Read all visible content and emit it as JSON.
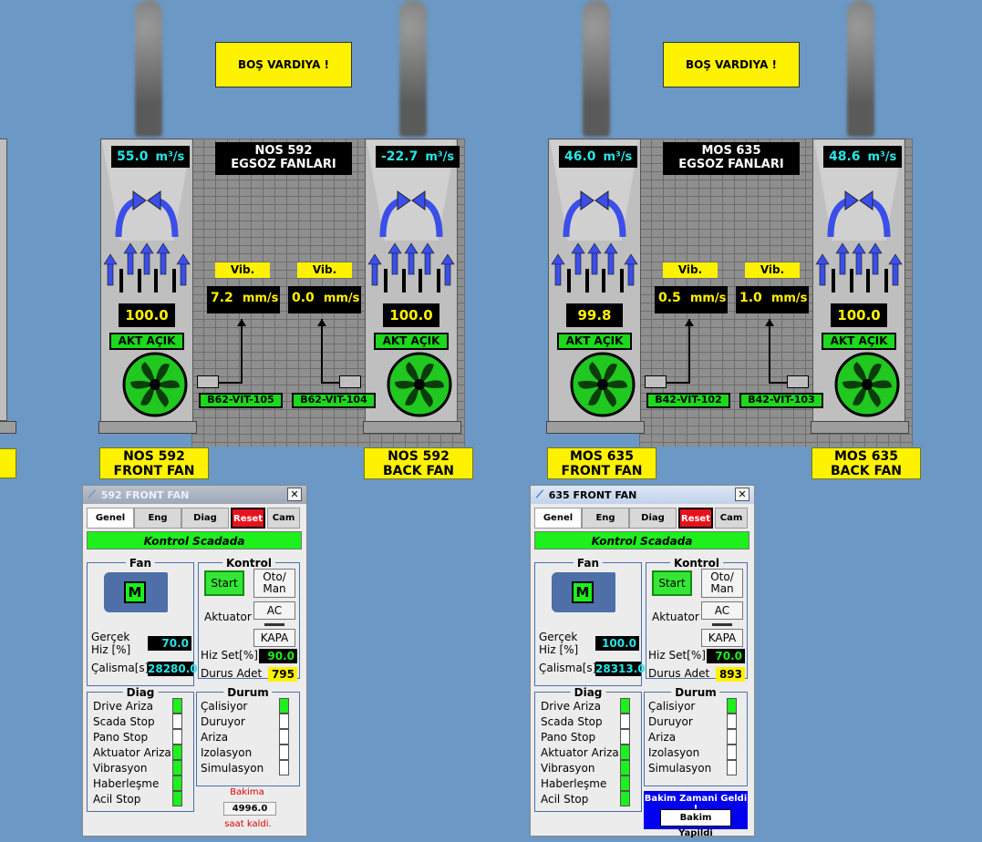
{
  "units": {
    "speed": "m³/s",
    "vib": "mm/s"
  },
  "vib_label": "Vib.",
  "stations": [
    {
      "shift_banner": "BOŞ VARDIYA !",
      "title_line1": "NOS 592",
      "title_line2": "EGSOZ FANLARI",
      "front": {
        "speed": "55.0",
        "percent": "100.0",
        "actuator": "AKT AÇIK",
        "name1": "NOS 592",
        "name2": "FRONT FAN",
        "vib": "7.2",
        "sensor": "B62-VIT-105"
      },
      "back": {
        "speed": "-22.7",
        "percent": "100.0",
        "actuator": "AKT AÇIK",
        "name1": "NOS 592",
        "name2": "BACK FAN",
        "vib": "0.0",
        "sensor": "B62-VIT-104"
      }
    },
    {
      "shift_banner": "BOŞ VARDIYA !",
      "title_line1": "MOS 635",
      "title_line2": "EGSOZ FANLARI",
      "front": {
        "speed": "46.0",
        "percent": "99.8",
        "actuator": "AKT AÇIK",
        "name1": "MOS 635",
        "name2": "FRONT FAN",
        "vib": "0.5",
        "sensor": "B42-VIT-102"
      },
      "back": {
        "speed": "48.6",
        "percent": "100.0",
        "actuator": "AKT AÇIK",
        "name1": "MOS 635",
        "name2": "BACK FAN",
        "vib": "1.0",
        "sensor": "B42-VIT-103"
      }
    }
  ],
  "panels": [
    {
      "title": "592 FRONT FAN",
      "tabs": [
        "Genel",
        "Eng",
        "Diag",
        "Reset",
        "Cam"
      ],
      "status_bar": "Kontrol Scadada",
      "fan_group": "Fan",
      "motor_label": "M",
      "real_speed_label1": "Gerçek",
      "real_speed_label2": "Hiz [%]",
      "real_speed": "70.0",
      "work_label": "Çalisma[s]",
      "work_value": "28280.0",
      "kontrol_group": "Kontrol",
      "start": "Start",
      "oto_man_1": "Oto/",
      "oto_man_2": "Man",
      "aktuator": "Aktuator",
      "ac": "AC",
      "kapa": "KAPA",
      "hiz_set_label": "Hiz Set[%]",
      "hiz_set": "90.0",
      "durus_label": "Durus Adet",
      "durus": "795",
      "diag_group": "Diag",
      "diag_items": [
        "Drive Ariza",
        "Scada Stop",
        "Pano Stop",
        "Aktuator Ariza",
        "Vibrasyon",
        "Haberleşme",
        "Acil Stop"
      ],
      "diag_states": [
        "g",
        "w",
        "w",
        "g",
        "g",
        "g",
        "g"
      ],
      "durum_group": "Durum",
      "durum_items": [
        "Çalisiyor",
        "Duruyor",
        "Ariza",
        "Izolasyon",
        "Simulasyon"
      ],
      "durum_states": [
        "g",
        "w",
        "w",
        "w",
        "w"
      ],
      "bakim_label": "Bakima",
      "bakim_value": "4996.0",
      "bakim_suffix": "saat kaldi."
    },
    {
      "title": "635 FRONT FAN",
      "tabs": [
        "Genel",
        "Eng",
        "Diag",
        "Reset",
        "Cam"
      ],
      "status_bar": "Kontrol Scadada",
      "fan_group": "Fan",
      "motor_label": "M",
      "real_speed_label1": "Gerçek",
      "real_speed_label2": "Hiz [%]",
      "real_speed": "100.0",
      "work_label": "Çalisma[s]",
      "work_value": "28313.0",
      "kontrol_group": "Kontrol",
      "start": "Start",
      "oto_man_1": "Oto/",
      "oto_man_2": "Man",
      "aktuator": "Aktuator",
      "ac": "AC",
      "kapa": "KAPA",
      "hiz_set_label": "Hiz Set[%]",
      "hiz_set": "70.0",
      "durus_label": "Durus Adet",
      "durus": "893",
      "diag_group": "Diag",
      "diag_items": [
        "Drive Ariza",
        "Scada Stop",
        "Pano Stop",
        "Aktuator Ariza",
        "Vibrasyon",
        "Haberleşme",
        "Acil Stop"
      ],
      "diag_states": [
        "g",
        "w",
        "w",
        "g",
        "g",
        "g",
        "g"
      ],
      "durum_group": "Durum",
      "durum_items": [
        "Çalisiyor",
        "Duruyor",
        "Ariza",
        "Izolasyon",
        "Simulasyon"
      ],
      "durum_states": [
        "g",
        "w",
        "w",
        "w",
        "w"
      ],
      "bakim_alert": "Bakim Zamani Geldi !",
      "bakim_done": "Bakim Yapildi"
    }
  ],
  "colors": {
    "background": "#6b98c4",
    "green": "#1df01d",
    "yellow": "#fff200",
    "cyan": "#26e6e6",
    "red": "#e8121e"
  }
}
